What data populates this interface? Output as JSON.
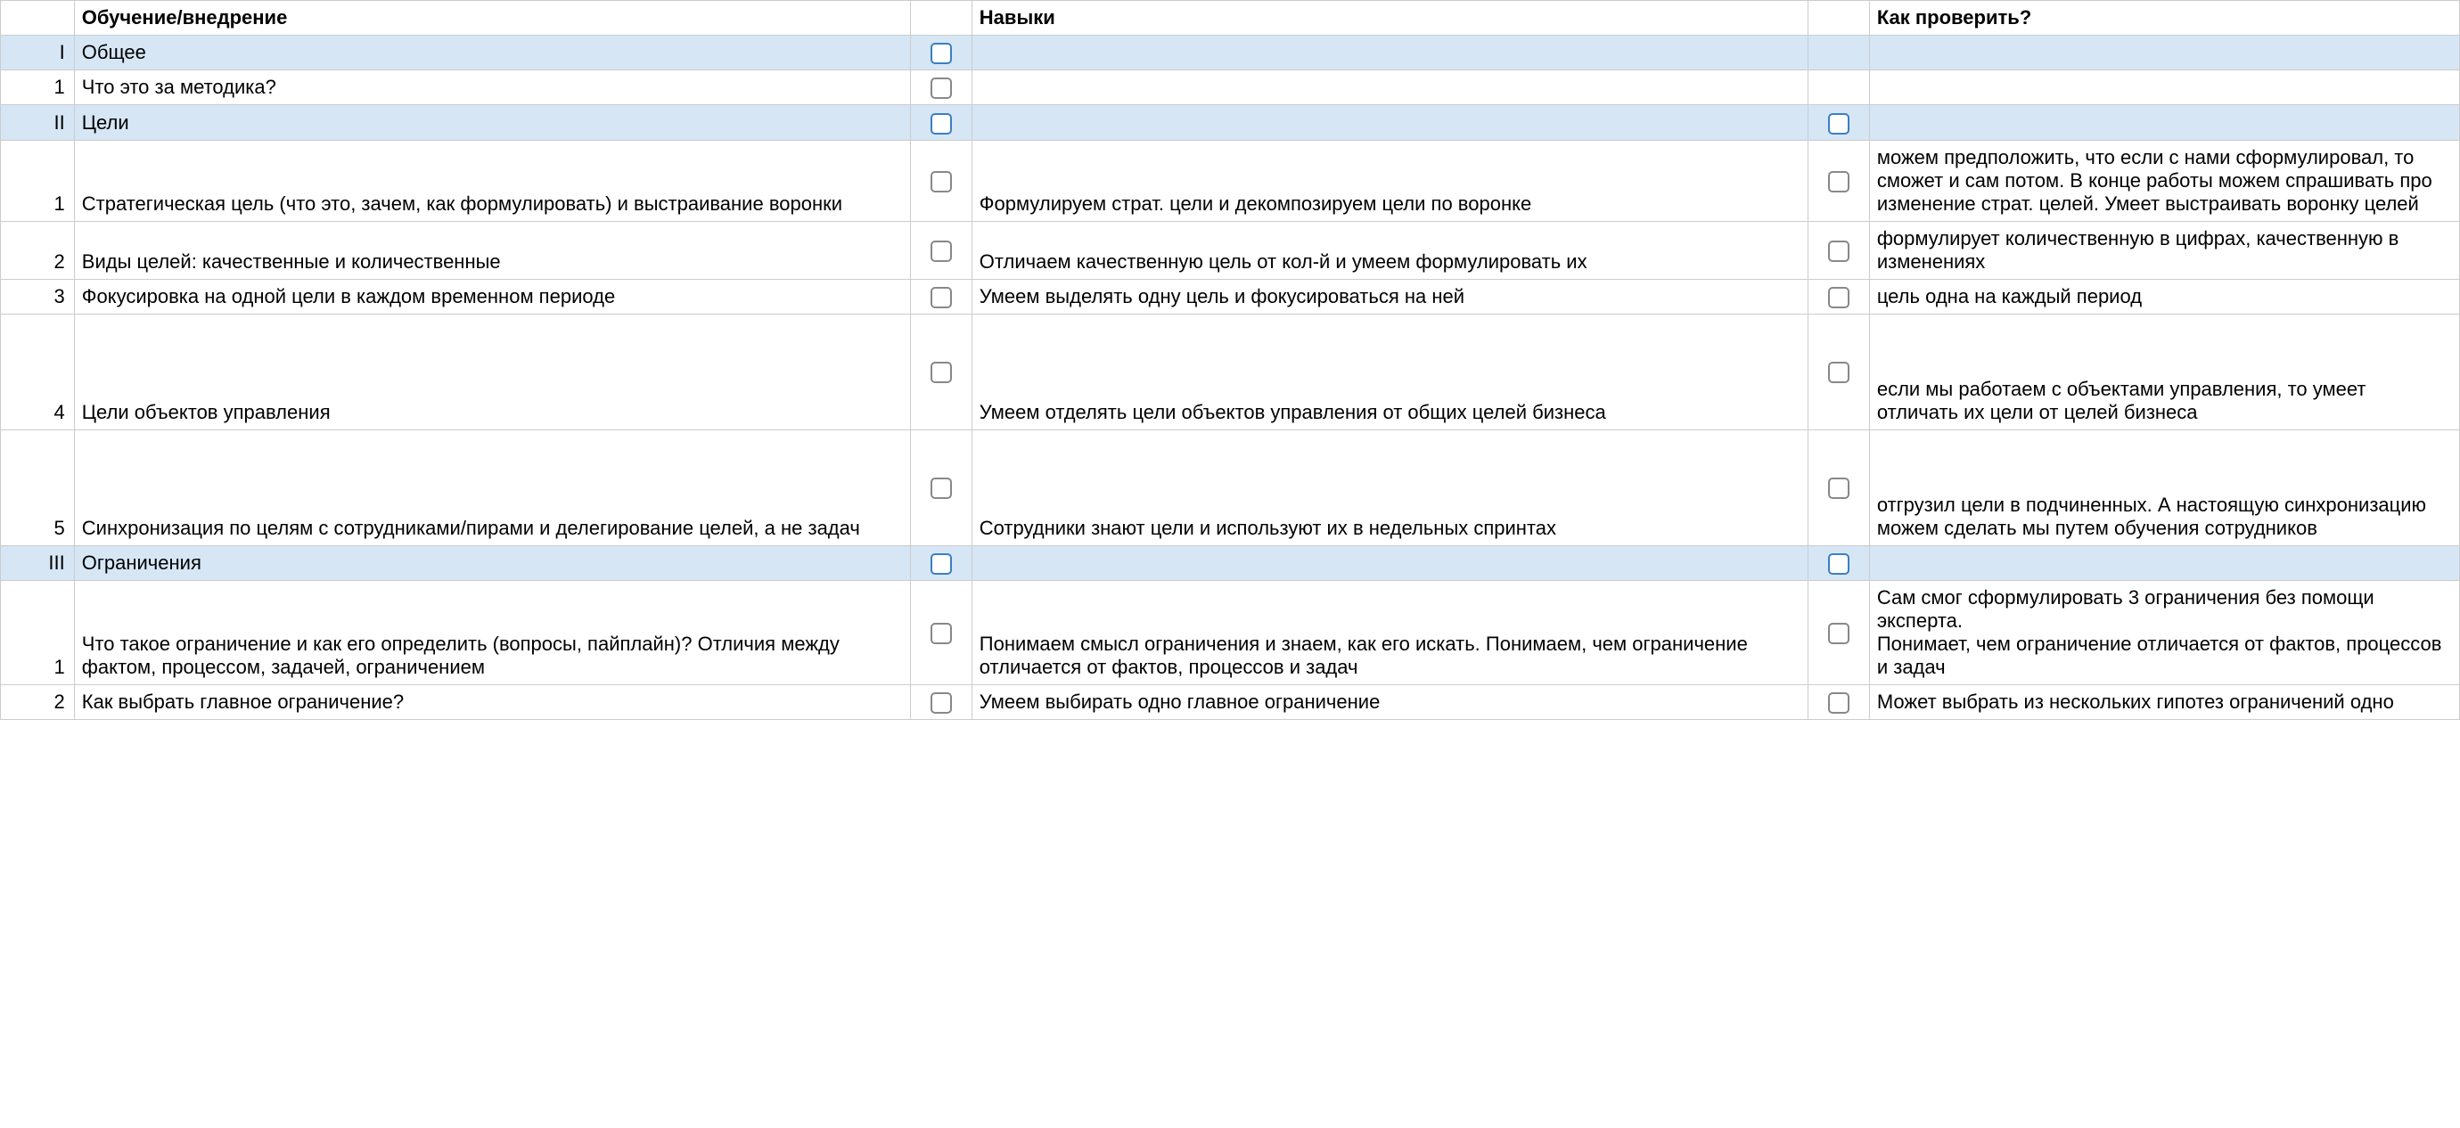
{
  "headers": {
    "num": "",
    "train": "Обучение/внедрение",
    "skill": "Навыки",
    "verify": "Как проверить?"
  },
  "rows": [
    {
      "type": "section",
      "num": "I",
      "train": "Общее",
      "cb1": true,
      "skill": "",
      "cb2": false,
      "verify": ""
    },
    {
      "type": "item",
      "num": "1",
      "train": "Что это за методика?",
      "cb1": true,
      "skill": "",
      "cb2": false,
      "verify": ""
    },
    {
      "type": "section",
      "num": "II",
      "train": "Цели",
      "cb1": true,
      "skill": "",
      "cb2": true,
      "verify": ""
    },
    {
      "type": "item",
      "num": "1",
      "train": "Стратегическая цель (что это, зачем, как формулировать) и выстраивание воронки",
      "cb1": true,
      "skill": "Формулируем страт. цели и декомпозируем цели по воронке",
      "cb2": true,
      "verify": "можем предположить, что если с нами сформулировал, то сможет и сам потом. В конце работы можем спрашивать про изменение страт. целей. Умеет выстраивать воронку целей"
    },
    {
      "type": "item",
      "num": "2",
      "train": "Виды целей: качественные и количественные",
      "cb1": true,
      "skill": "Отличаем качественную цель от кол-й и умеем формулировать их",
      "cb2": true,
      "verify": "формулирует количественную в цифрах, качественную в изменениях"
    },
    {
      "type": "item",
      "num": "3",
      "train": "Фокусировка на одной цели в каждом временном периоде",
      "cb1": true,
      "skill": "Умеем выделять одну цель и фокусироваться на ней",
      "cb2": true,
      "verify": "цель одна на каждый период"
    },
    {
      "type": "item",
      "tall": true,
      "num": "4",
      "train": "Цели объектов управления",
      "cb1": true,
      "skill": "Умеем отделять цели объектов управления от общих целей бизнеса",
      "cb2": true,
      "verify": "если мы работаем с объектами управления, то умеет отличать их цели от целей бизнеса"
    },
    {
      "type": "item",
      "tall": true,
      "num": "5",
      "train": "Синхронизация по целям с сотрудниками/пирами и делегирование целей, а не задач",
      "cb1": true,
      "skill": "Сотрудники знают цели и используют их в недельных спринтах",
      "cb2": true,
      "verify": "отгрузил цели в подчиненных. А настоящую синхронизацию можем сделать мы путем обучения сотрудников"
    },
    {
      "type": "section",
      "num": "III",
      "train": "Ограничения",
      "cb1": true,
      "skill": "",
      "cb2": true,
      "verify": ""
    },
    {
      "type": "item",
      "num": "1",
      "train": "Что такое ограничение и как его определить (вопросы, пайплайн)? Отличия между фактом, процессом, задачей, ограничением",
      "cb1": true,
      "skill": "Понимаем смысл ограничения и знаем, как его искать. Понимаем, чем ограничение отличается от фактов, процессов и задач",
      "cb2": true,
      "verify": "Сам смог сформулировать 3 ограничения без помощи эксперта.\nПонимает, чем ограничение отличается от фактов, процессов и задач"
    },
    {
      "type": "item",
      "num": "2",
      "train": "Как выбрать главное ограничение?",
      "cb1": true,
      "skill": "Умеем выбирать одно главное ограничение",
      "cb2": true,
      "verify": "Может выбрать из нескольких гипотез ограничений одно"
    }
  ]
}
